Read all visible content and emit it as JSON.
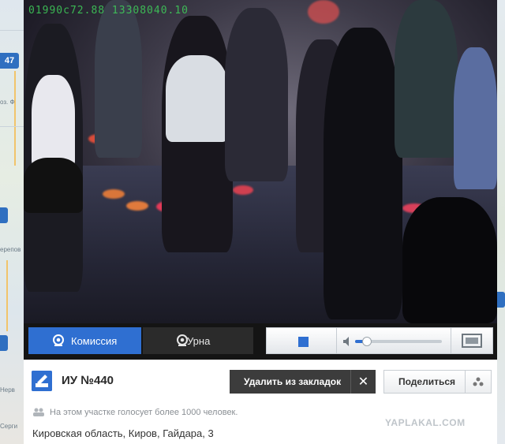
{
  "map": {
    "badges": [
      "47"
    ],
    "place_names": [
      "оз. Ф",
      "ерепов",
      "Нерв",
      "Серги"
    ]
  },
  "video": {
    "timestamp": "01990c72.88 13308040.10"
  },
  "controls": {
    "komissiya_label": "Комиссия",
    "urna_label": "Урна",
    "volume_percent": 10
  },
  "station": {
    "title": "ИУ №440",
    "delete_bookmark_label": "Удалить из закладок",
    "close_glyph": "✕",
    "share_label": "Поделиться",
    "voters_text": "На этом участке голосует более 1000 человек.",
    "address": "Кировская область, Киров, Гайдара, 3"
  },
  "watermark": "YAPLAKAL.COM",
  "colors": {
    "accent": "#2f6fd1",
    "dark_button": "#3c3c3c",
    "timestamp": "#3fd05a"
  }
}
